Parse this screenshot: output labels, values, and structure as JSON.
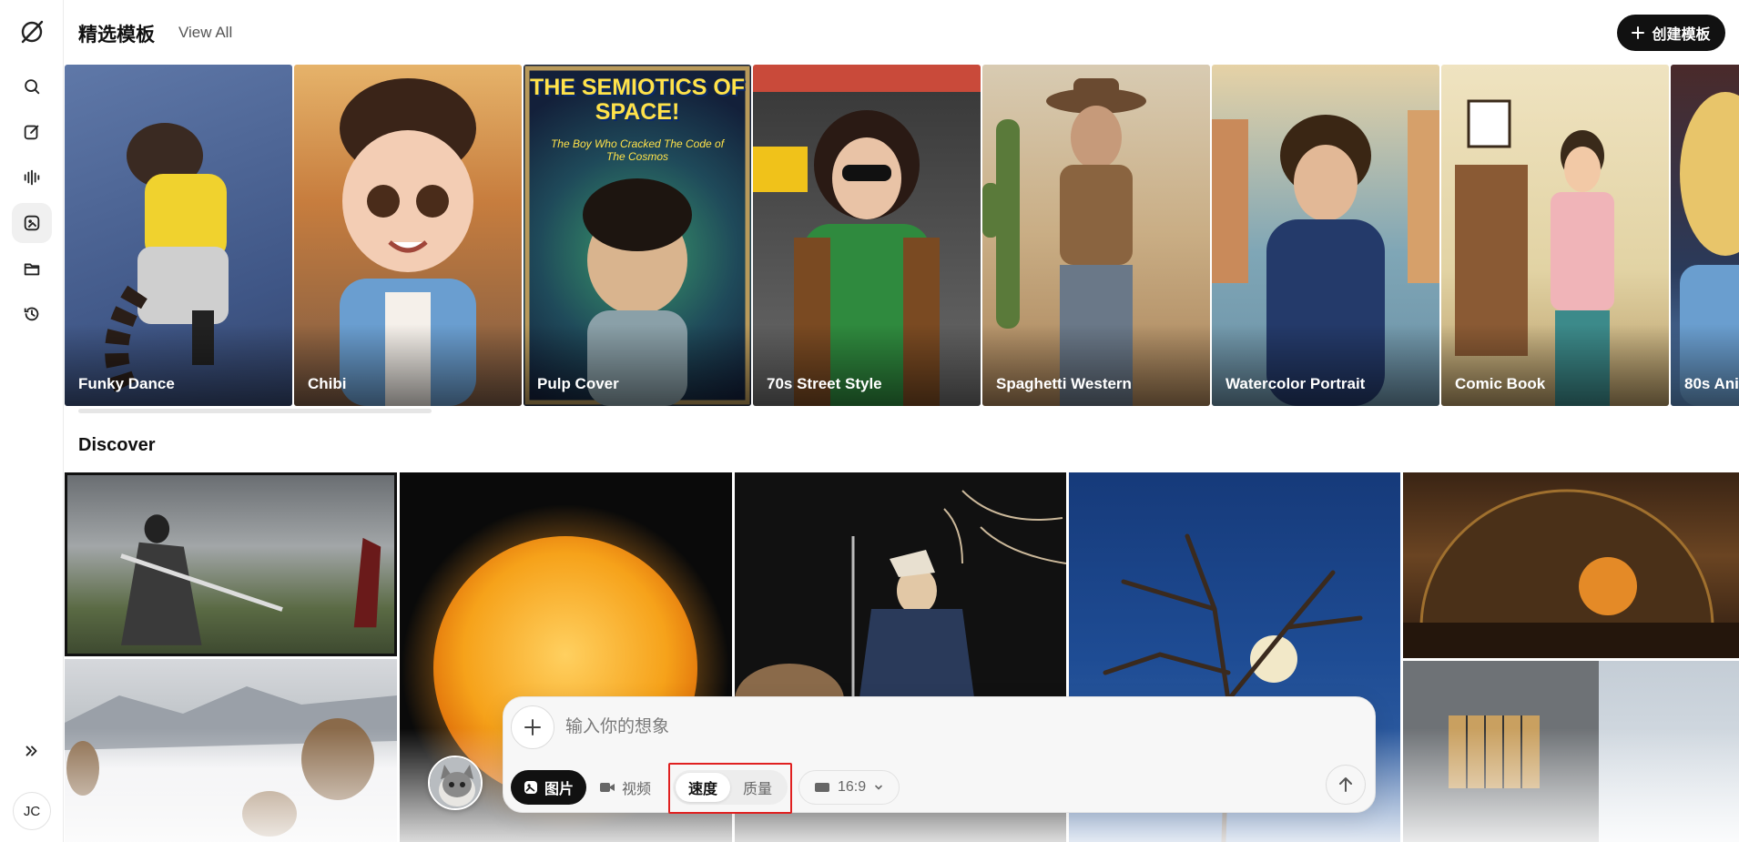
{
  "header": {
    "title": "精选模板",
    "view_all": "View All",
    "create_label": "创建模板"
  },
  "templates": [
    {
      "label": "Funky Dance"
    },
    {
      "label": "Chibi"
    },
    {
      "label": "Pulp Cover",
      "cover_title": "THE SEMIOTICS OF SPACE!",
      "cover_sub": "The Boy Who Cracked The Code of The Cosmos"
    },
    {
      "label": "70s Street Style"
    },
    {
      "label": "Spaghetti Western"
    },
    {
      "label": "Watercolor Portrait"
    },
    {
      "label": "Comic Book"
    },
    {
      "label": "80s Ani"
    }
  ],
  "discover": {
    "title": "Discover"
  },
  "composer": {
    "placeholder": "输入你的想象",
    "mode_image": "图片",
    "mode_video": "视频",
    "speed": "速度",
    "quality": "质量",
    "ratio": "16:9"
  },
  "user": {
    "initials": "JC"
  },
  "icons": [
    "logo-icon",
    "search-icon",
    "edit-icon",
    "audio-icon",
    "templates-icon",
    "folder-icon",
    "history-icon",
    "expand-icon",
    "plus-icon",
    "image-icon",
    "video-icon",
    "aspect-icon",
    "chevron-down-icon",
    "arrow-up-icon"
  ]
}
